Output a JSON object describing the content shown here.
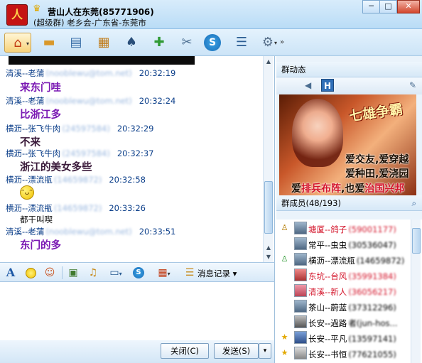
{
  "window": {
    "group_name": "营山人在东莞(85771906)",
    "group_subtitle": "(超级群) 老乡会-广东省-东莞市",
    "logo_text": "人",
    "controls": {
      "minimize": "─",
      "maximize": "□",
      "close": "✕"
    }
  },
  "toolbar": {
    "items": [
      {
        "icon": "home-icon",
        "glyph": "⌂"
      },
      {
        "icon": "folder-icon",
        "glyph": "▬"
      },
      {
        "icon": "album-icon",
        "glyph": "▤"
      },
      {
        "icon": "board-icon",
        "glyph": "▦"
      },
      {
        "icon": "game-icon",
        "glyph": "♠"
      },
      {
        "icon": "add-app-icon",
        "glyph": "✚"
      },
      {
        "icon": "tools-icon",
        "glyph": "✂"
      },
      {
        "icon": "soso-icon",
        "glyph": "S"
      },
      {
        "icon": "notice-icon",
        "glyph": "☰"
      },
      {
        "icon": "settings-icon",
        "glyph": "⚙"
      }
    ],
    "more": "»"
  },
  "chat": {
    "messages": [
      {
        "sender": "清溪--老蒲",
        "id": "(nooblewu@tom.net)",
        "time": "20:32:19",
        "text": "来东门哇",
        "style": "purple"
      },
      {
        "sender": "清溪--老蒲",
        "id": "(nooblewu@tom.net)",
        "time": "20:32:24",
        "text": "比浙江多",
        "style": "purple"
      },
      {
        "sender": "横沥--张飞牛肉",
        "id": "(24597584)",
        "time": "20:32:29",
        "text": "不来",
        "style": "dark"
      },
      {
        "sender": "横沥--张飞牛肉",
        "id": "(24597584)",
        "time": "20:32:37",
        "text": "浙江的美女多些",
        "style": "dark"
      },
      {
        "sender": "横沥--漂流瓶",
        "id": "(14659872)",
        "time": "20:32:58",
        "text": "",
        "style": "smiley"
      },
      {
        "sender": "横沥--漂流瓶",
        "id": "(14659872)",
        "time": "20:33:26",
        "text": "都干叫喫",
        "style": "small"
      },
      {
        "sender": "清溪--老蒲",
        "id": "(nooblewu@tom.net)",
        "time": "20:33:51",
        "text": "东门的多",
        "style": "purple"
      }
    ],
    "smiley_glyph": "ᵔᴗᵔ"
  },
  "input_toolbar": {
    "font_icon": "A",
    "history_label": "消息记录",
    "dropdown": "▾"
  },
  "bottom": {
    "close_label": "关闭(C)",
    "send_label": "发送(S)",
    "send_dropdown": "▾"
  },
  "right": {
    "dynamic_title": "群动态",
    "ad": {
      "logo": "七雄争霸",
      "line1": "爱交友,爱穿越",
      "line2": "爱种田,爱浇园",
      "line3_a": "爱",
      "line3_b": "排兵布阵",
      "line3_c": ",也爱",
      "line3_d": "治国兴邦"
    },
    "members_title": "群成员(48/193)",
    "members": [
      {
        "name": "塘厦--鸽子",
        "id": "(59001177)",
        "color": "#d4142a",
        "badge": "owner"
      },
      {
        "name": "常平--虫虫",
        "id": "(30536047)",
        "color": "#111",
        "badge": "none"
      },
      {
        "name": "横沥--漂流瓶",
        "id": "(14659872)",
        "color": "#111",
        "badge": "admin"
      },
      {
        "name": "东坑--台风",
        "id": "(35991384)",
        "color": "#d4142a",
        "badge": "none"
      },
      {
        "name": "清溪--新人",
        "id": "(36056217)",
        "color": "#d4142a",
        "badge": "none"
      },
      {
        "name": "茶山--蔚蓝",
        "id": "(37312296)",
        "color": "#111",
        "badge": "none"
      },
      {
        "name": "长安--過路",
        "id": "者(jun-hos...",
        "color": "#111",
        "badge": "none"
      },
      {
        "name": "长安--平凡",
        "id": "(13597141)",
        "color": "#111",
        "badge": "star"
      },
      {
        "name": "长安--书恒",
        "id": "(77621055)",
        "color": "#111",
        "badge": "star"
      }
    ]
  }
}
